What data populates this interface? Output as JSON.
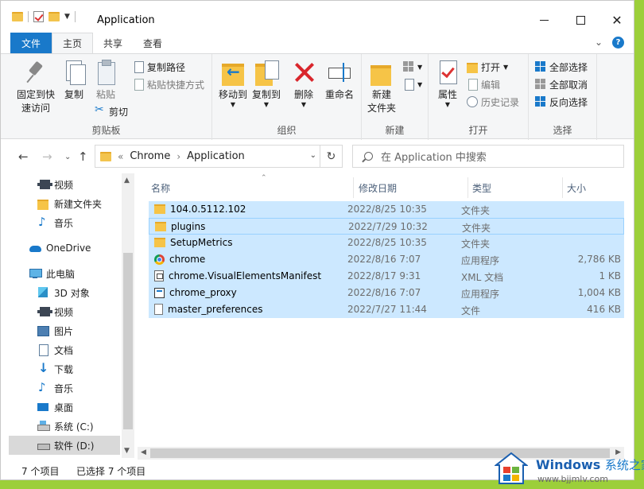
{
  "window": {
    "title": "Application"
  },
  "tabs": [
    {
      "label": "文件"
    },
    {
      "label": "主页"
    },
    {
      "label": "共享"
    },
    {
      "label": "查看"
    }
  ],
  "ribbon": {
    "clipboard": {
      "group_label": "剪贴板",
      "pin_quick_access": "固定到快速访问",
      "pin_line1": "固定到快",
      "pin_line2": "速访问",
      "copy": "复制",
      "paste": "粘贴",
      "copy_path": "复制路径",
      "paste_shortcut": "粘贴快捷方式",
      "cut": "剪切"
    },
    "organize": {
      "group_label": "组织",
      "move_to": "移动到",
      "copy_to": "复制到",
      "delete": "删除",
      "rename": "重命名"
    },
    "new": {
      "group_label": "新建",
      "new_folder_line1": "新建",
      "new_folder_line2": "文件夹"
    },
    "open": {
      "group_label": "打开",
      "properties": "属性",
      "open": "打开",
      "edit": "编辑",
      "history": "历史记录"
    },
    "select": {
      "group_label": "选择",
      "select_all": "全部选择",
      "select_none": "全部取消",
      "invert": "反向选择"
    }
  },
  "address": {
    "overflow": "«",
    "crumbs": [
      "Chrome",
      "Application"
    ]
  },
  "search": {
    "placeholder": "在 Application 中搜索"
  },
  "sidebar": {
    "items": [
      {
        "label": "视频",
        "icon": "video-icon"
      },
      {
        "label": "新建文件夹",
        "icon": "folder-icon"
      },
      {
        "label": "音乐",
        "icon": "music-icon"
      },
      {
        "label": "OneDrive",
        "icon": "cloud-icon"
      },
      {
        "label": "此电脑",
        "icon": "pc-icon"
      },
      {
        "label": "3D 对象",
        "icon": "3d-objects-icon"
      },
      {
        "label": "视频",
        "icon": "video-icon"
      },
      {
        "label": "图片",
        "icon": "pictures-icon"
      },
      {
        "label": "文档",
        "icon": "documents-icon"
      },
      {
        "label": "下载",
        "icon": "download-icon"
      },
      {
        "label": "音乐",
        "icon": "music-icon"
      },
      {
        "label": "桌面",
        "icon": "desktop-icon"
      },
      {
        "label": "系统 (C:)",
        "icon": "system-drive-icon"
      },
      {
        "label": "软件 (D:)",
        "icon": "drive-icon"
      }
    ]
  },
  "columns": {
    "name": "名称",
    "date": "修改日期",
    "type": "类型",
    "size": "大小"
  },
  "files": [
    {
      "name": "104.0.5112.102",
      "date": "2022/8/25 10:35",
      "type": "文件夹",
      "size": "",
      "icon": "folder-icon"
    },
    {
      "name": "plugins",
      "date": "2022/7/29 10:32",
      "type": "文件夹",
      "size": "",
      "icon": "folder-icon"
    },
    {
      "name": "SetupMetrics",
      "date": "2022/8/25 10:35",
      "type": "文件夹",
      "size": "",
      "icon": "folder-icon"
    },
    {
      "name": "chrome",
      "date": "2022/8/16 7:07",
      "type": "应用程序",
      "size": "2,786 KB",
      "icon": "chrome-icon"
    },
    {
      "name": "chrome.VisualElementsManifest",
      "date": "2022/8/17 9:31",
      "type": "XML 文档",
      "size": "1 KB",
      "icon": "xml-file-icon"
    },
    {
      "name": "chrome_proxy",
      "date": "2022/8/16 7:07",
      "type": "应用程序",
      "size": "1,004 KB",
      "icon": "app-icon"
    },
    {
      "name": "master_preferences",
      "date": "2022/7/27 11:44",
      "type": "文件",
      "size": "416 KB",
      "icon": "file-icon"
    }
  ],
  "status": {
    "count": "7 个项目",
    "selected": "已选择 7 个项目"
  },
  "watermark": {
    "brand": "Windows",
    "brand_cn": "系统之家",
    "url": "www.bjjmlv.com"
  }
}
